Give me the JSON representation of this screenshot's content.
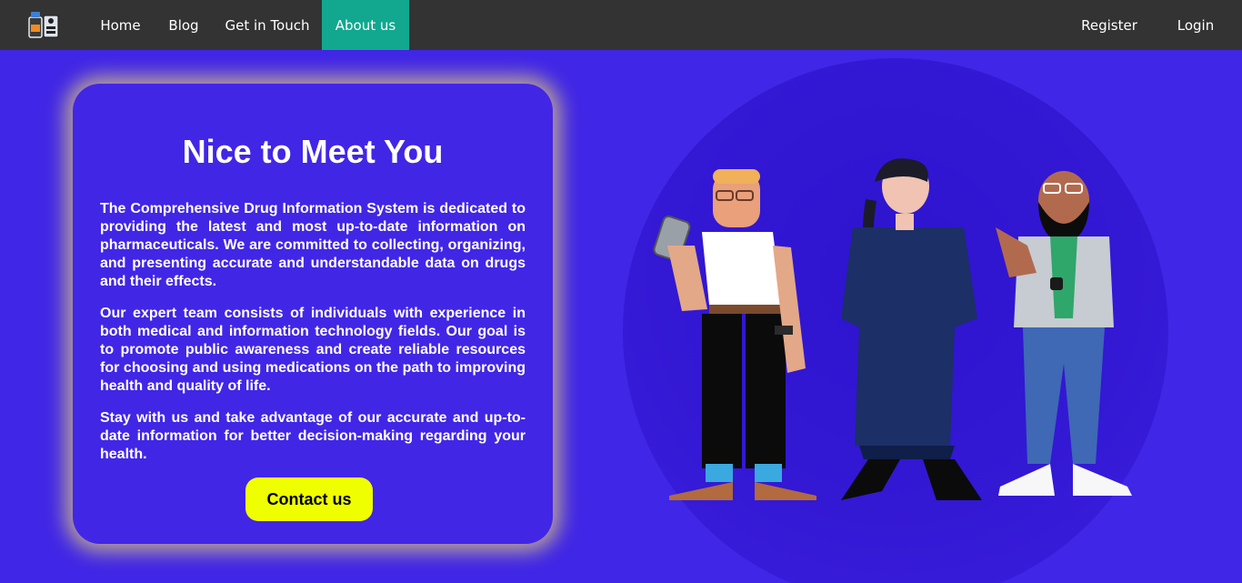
{
  "nav": {
    "logo_icon": "pharmacy-logo-icon",
    "items": [
      {
        "label": "Home"
      },
      {
        "label": "Blog"
      },
      {
        "label": "Get in Touch"
      },
      {
        "label": "About us",
        "active": true
      }
    ],
    "right_items": [
      {
        "label": "Register"
      },
      {
        "label": "Login"
      }
    ],
    "active_color": "#11a88f",
    "bar_color": "#333333"
  },
  "about": {
    "title": "Nice to Meet You",
    "paragraphs": [
      "The Comprehensive Drug Information System is dedicated to providing the latest and most up-to-date information on pharmaceuticals. We are committed to collecting, organizing, and presenting accurate and understandable data on drugs and their effects.",
      "Our expert team consists of individuals with experience in both medical and information technology fields. Our goal is to promote public awareness and create reliable resources for choosing and using medications on the path to improving health and quality of life.",
      "Stay with us and take advantage of our accurate and up-to-date information for better decision-making regarding your health."
    ],
    "cta_label": "Contact us",
    "cta_color": "#f0ff00",
    "background_color": "#4026e6"
  },
  "illustration": {
    "icon": "team-illustration",
    "description_visible": false
  }
}
